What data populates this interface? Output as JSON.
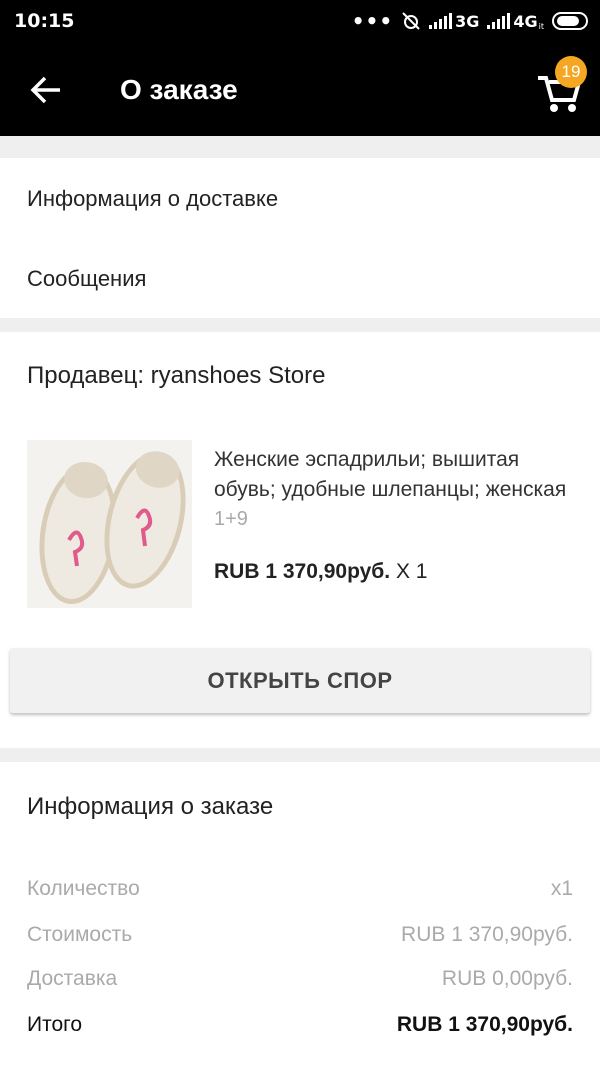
{
  "status_bar": {
    "time": "10:15",
    "dots": "•••",
    "net1": "3G",
    "net2": "4G",
    "net2_sub": "it"
  },
  "app_bar": {
    "title": "О заказе",
    "cart_count": "19"
  },
  "links": {
    "delivery_info": "Информация о доставке",
    "messages": "Сообщения"
  },
  "seller": {
    "label": "Продавец: ryanshoes Store"
  },
  "product": {
    "name": "Женские эспадрильи; вышитая обувь; удобные шлепанцы; женская",
    "variant": "1+9",
    "price": "RUB 1 370,90руб.",
    "qty": "X 1"
  },
  "dispute_button": "ОТКРЫТЬ СПОР",
  "order_info": {
    "title": "Информация о заказе",
    "rows": [
      {
        "label": "Количество",
        "value": "x1"
      },
      {
        "label": "Стоимость",
        "value": "RUB 1 370,90руб."
      },
      {
        "label": "Доставка",
        "value": "RUB 0,00руб."
      },
      {
        "label": "Итого",
        "value": "RUB 1 370,90руб."
      }
    ]
  },
  "colors": {
    "bar": "#000000",
    "badge": "#f5a623",
    "background": "#efefef"
  }
}
